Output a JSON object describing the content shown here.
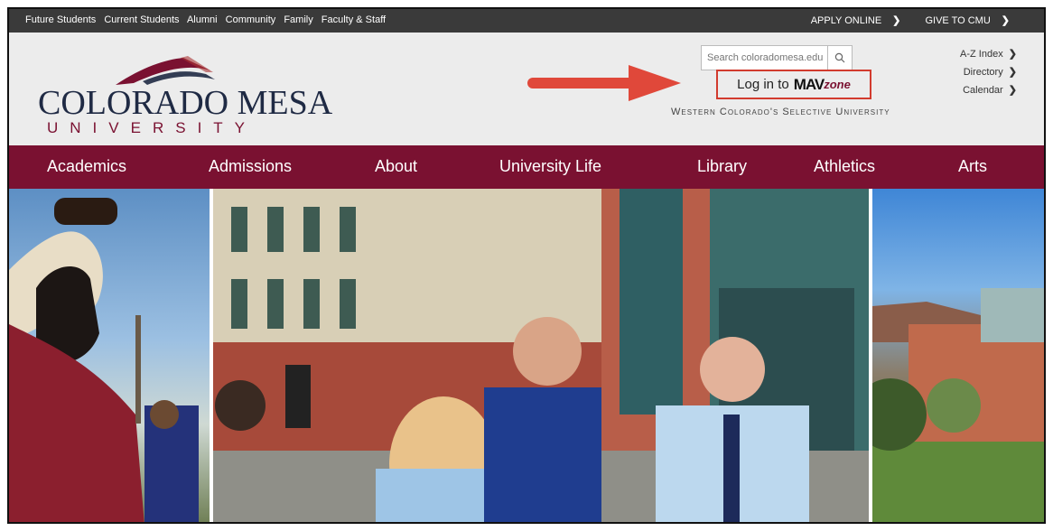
{
  "topbar": {
    "left_links": [
      "Future Students",
      "Current Students",
      "Alumni",
      "Community",
      "Family",
      "Faculty & Staff"
    ],
    "apply": "APPLY ONLINE",
    "give": "GIVE TO CMU"
  },
  "logo": {
    "line1": "COLORADO MESA",
    "line2": "UNIVERSITY"
  },
  "search": {
    "placeholder": "Search coloradomesa.edu"
  },
  "login": {
    "prefix": "Log in to",
    "mav": "MAV",
    "zone": "zone"
  },
  "tagline": "Western Colorado's Selective University",
  "quicklinks": [
    "A-Z Index",
    "Directory",
    "Calendar"
  ],
  "nav": [
    "Academics",
    "Admissions",
    "About",
    "University Life",
    "Library",
    "Athletics",
    "Arts"
  ],
  "colors": {
    "maroon": "#7a1131",
    "topbar": "#3a3a3a",
    "highlight": "#d23b2e",
    "navy": "#1f2a44"
  }
}
